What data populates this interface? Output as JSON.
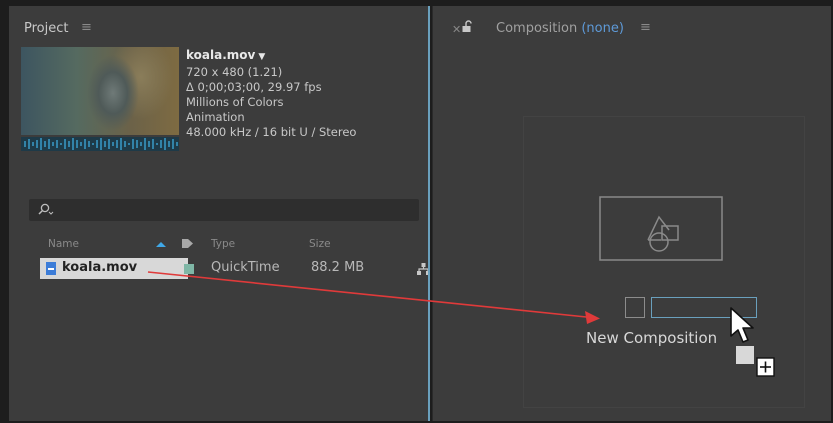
{
  "project_panel": {
    "title": "Project",
    "file_info": {
      "name": "koala.mov",
      "dimensions": "720 x 480 (1.21)",
      "duration_fps": "Δ 0;00;03;00, 29.97 fps",
      "colors": "Millions of Colors",
      "codec": "Animation",
      "audio": "48.000 kHz / 16 bit U / Stereo"
    },
    "columns": {
      "name": "Name",
      "type": "Type",
      "size": "Size"
    },
    "items": [
      {
        "name": "koala.mov",
        "type": "QuickTime",
        "size": "88.2 MB",
        "label_color": "#7fb7a6"
      }
    ]
  },
  "composition_panel": {
    "title": "Composition",
    "comp_name": "(none)",
    "new_composition_label": "New Composition"
  },
  "colors": {
    "accent": "#5e9ad8",
    "drag_arrow": "#e03a3a",
    "panel_bg": "#3c3c3c"
  },
  "icons": [
    "menu-icon",
    "search-icon",
    "sort-ascending-icon",
    "label-tag-icon",
    "file-icon",
    "flowchart-icon",
    "close-icon",
    "lock-icon",
    "new-composition-icon",
    "pointer-cursor-icon",
    "plus-icon"
  ]
}
